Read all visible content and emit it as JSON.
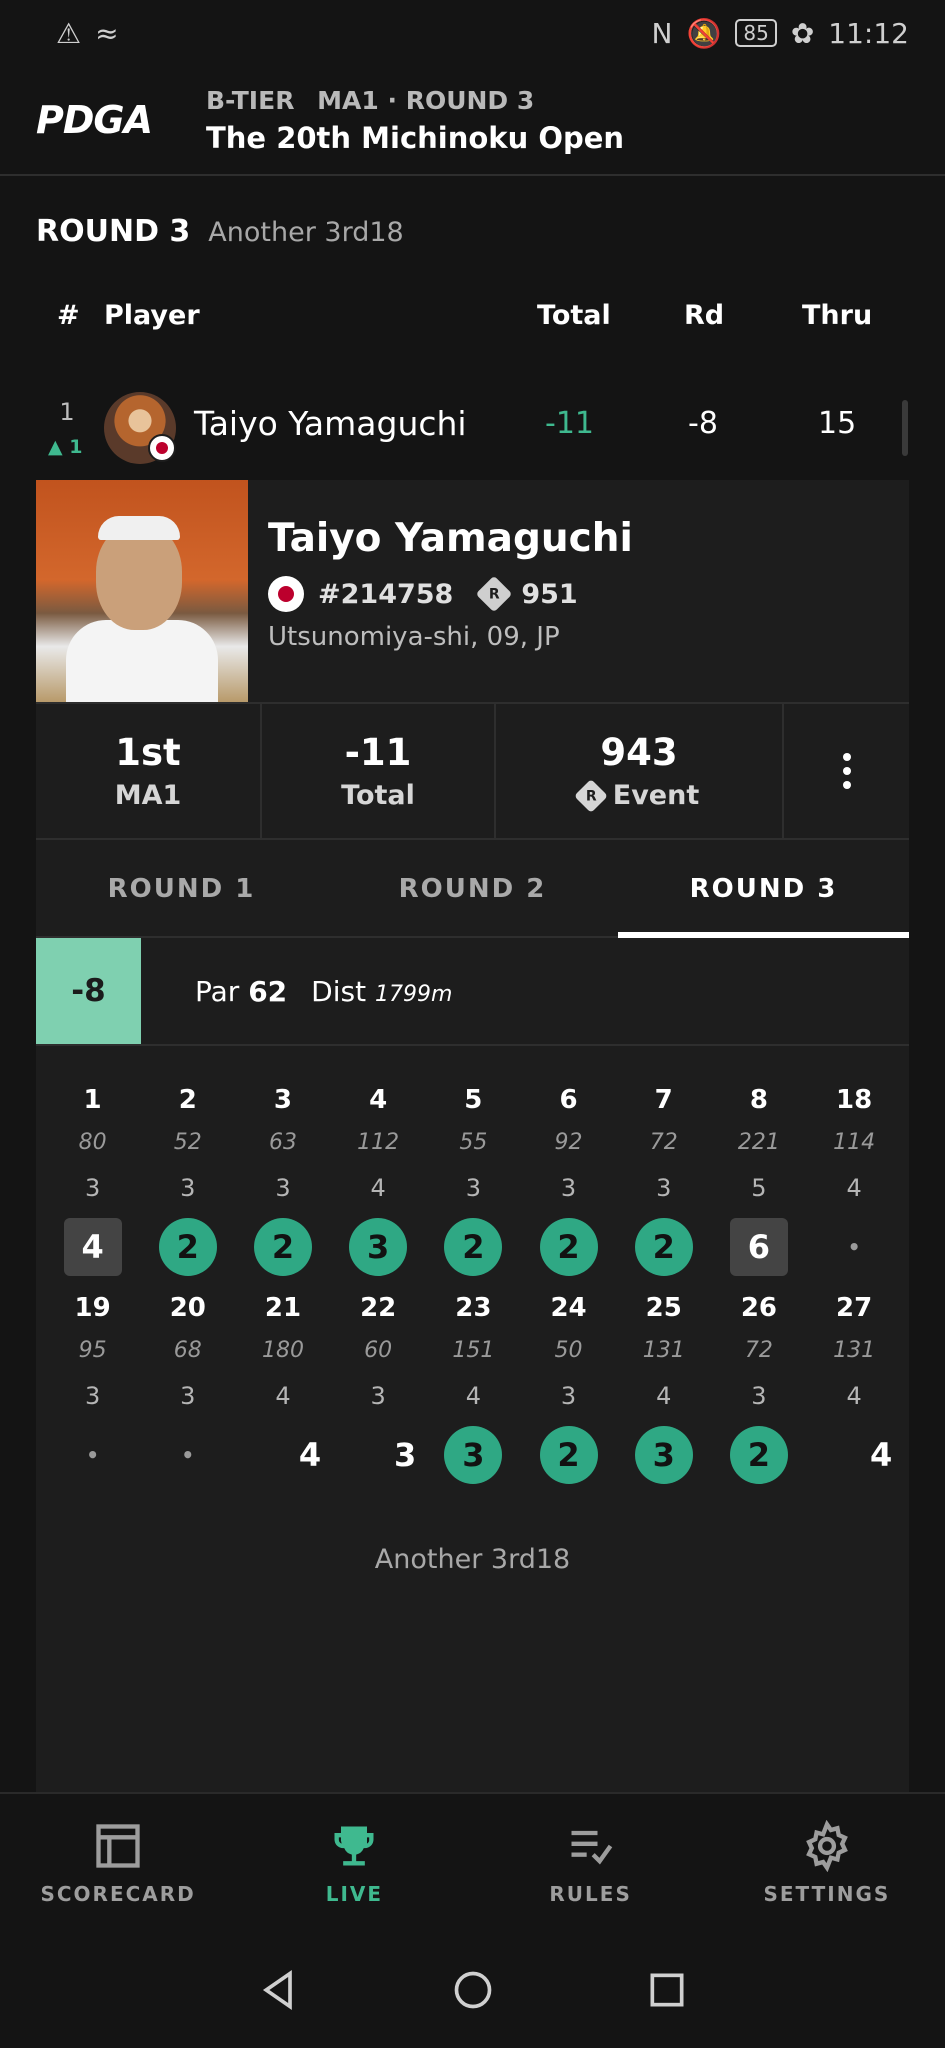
{
  "status_bar": {
    "battery": "85",
    "time": "11:12"
  },
  "header": {
    "logo": "PDGA",
    "tier": "B-TIER",
    "division_round": "MA1 · ROUND 3",
    "event_title": "The 20th Michinoku Open"
  },
  "round_heading": {
    "label": "ROUND 3",
    "course": "Another 3rd18"
  },
  "columns": {
    "rank": "#",
    "player": "Player",
    "total": "Total",
    "rd": "Rd",
    "thru": "Thru"
  },
  "player_row": {
    "rank": "1",
    "movement": "1",
    "name": "Taiyo Yamaguchi",
    "total": "-11",
    "rd": "-8",
    "thru": "15"
  },
  "player_card": {
    "name": "Taiyo Yamaguchi",
    "pdga_number": "#214758",
    "rating": "951",
    "location": "Utsunomiya-shi, 09, JP",
    "stats": [
      {
        "value": "1st",
        "label": "MA1"
      },
      {
        "value": "-11",
        "label": "Total"
      },
      {
        "value": "943",
        "label": "Event"
      }
    ]
  },
  "tabs": [
    {
      "label": "ROUND 1",
      "active": false
    },
    {
      "label": "ROUND 2",
      "active": false
    },
    {
      "label": "ROUND 3",
      "active": true
    }
  ],
  "round_info": {
    "score": "-8",
    "par_label": "Par",
    "par_value": "62",
    "dist_label": "Dist",
    "dist_value": "1799m"
  },
  "holes_rows": [
    [
      {
        "hole": "1",
        "dist": "80",
        "par": "3",
        "score": "4",
        "type": "bogey"
      },
      {
        "hole": "2",
        "dist": "52",
        "par": "3",
        "score": "2",
        "type": "birdie"
      },
      {
        "hole": "3",
        "dist": "63",
        "par": "3",
        "score": "2",
        "type": "birdie"
      },
      {
        "hole": "4",
        "dist": "112",
        "par": "4",
        "score": "3",
        "type": "birdie"
      },
      {
        "hole": "5",
        "dist": "55",
        "par": "3",
        "score": "2",
        "type": "birdie"
      },
      {
        "hole": "6",
        "dist": "92",
        "par": "3",
        "score": "2",
        "type": "birdie"
      },
      {
        "hole": "7",
        "dist": "72",
        "par": "3",
        "score": "2",
        "type": "birdie"
      },
      {
        "hole": "8",
        "dist": "221",
        "par": "5",
        "score": "6",
        "type": "bogey"
      },
      {
        "hole": "18",
        "dist": "114",
        "par": "4",
        "score": "•",
        "type": "empty"
      }
    ],
    [
      {
        "hole": "19",
        "dist": "95",
        "par": "3",
        "score": "•",
        "type": "empty"
      },
      {
        "hole": "20",
        "dist": "68",
        "par": "3",
        "score": "•",
        "type": "empty"
      },
      {
        "hole": "21",
        "dist": "180",
        "par": "4",
        "score": "4",
        "type": "par"
      },
      {
        "hole": "22",
        "dist": "60",
        "par": "3",
        "score": "3",
        "type": "par"
      },
      {
        "hole": "23",
        "dist": "151",
        "par": "4",
        "score": "3",
        "type": "birdie"
      },
      {
        "hole": "24",
        "dist": "50",
        "par": "3",
        "score": "2",
        "type": "birdie"
      },
      {
        "hole": "25",
        "dist": "131",
        "par": "4",
        "score": "3",
        "type": "birdie"
      },
      {
        "hole": "26",
        "dist": "72",
        "par": "3",
        "score": "2",
        "type": "birdie"
      },
      {
        "hole": "27",
        "dist": "131",
        "par": "4",
        "score": "4",
        "type": "par"
      }
    ]
  ],
  "course_footer": "Another 3rd18",
  "bottom_nav": [
    {
      "label": "SCORECARD",
      "icon": "scorecard-icon",
      "active": false
    },
    {
      "label": "LIVE",
      "icon": "trophy-icon",
      "active": true
    },
    {
      "label": "RULES",
      "icon": "rules-icon",
      "active": false
    },
    {
      "label": "SETTINGS",
      "icon": "gear-icon",
      "active": false
    }
  ],
  "colors": {
    "accent": "#3fb98f",
    "birdie": "#2fa884",
    "round_score_bg": "#7fd0b0",
    "background": "#141414",
    "card": "#1d1d1d"
  }
}
